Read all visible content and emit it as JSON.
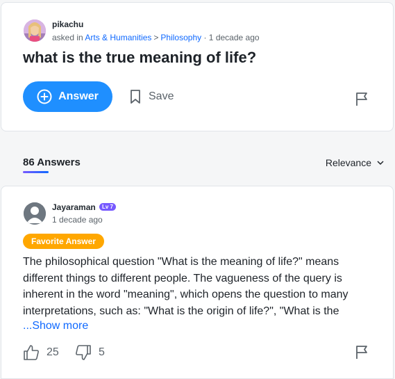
{
  "question": {
    "author": "pikachu",
    "asked_in_prefix": "asked in ",
    "category": "Arts & Humanities",
    "breadcrumb_sep": ">",
    "subcategory": "Philosophy",
    "time": " · 1 decade ago",
    "title": "what is the true meaning of life?",
    "answer_label": "Answer",
    "save_label": "Save"
  },
  "answers_header": {
    "count_label": "86 Answers",
    "sort_label": "Relevance"
  },
  "answer": {
    "author": "Jayaraman",
    "level": "Lv 7",
    "time": "1 decade ago",
    "badge": "Favorite Answer",
    "text": "The philosophical question \"What is the meaning of life?\" means different things to different people. The vagueness of the query is inherent in the word \"meaning\", which opens the question to many interpretations, such as: \"What is the origin of life?\", \"What is the",
    "show_more": "...Show more",
    "upvotes": "25",
    "downvotes": "5"
  },
  "colors": {
    "accent": "#1f8fff",
    "link": "#0f69ff",
    "level_badge": "#7759ff",
    "favorite_badge": "#ffa700"
  }
}
